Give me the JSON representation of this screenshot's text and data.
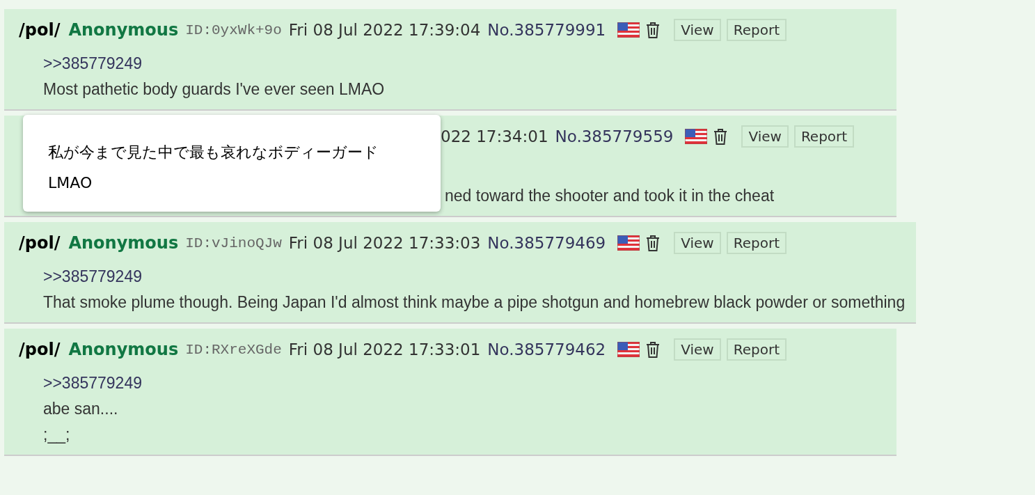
{
  "posts": [
    {
      "board": "/pol/",
      "name": "Anonymous",
      "id": "ID:0yxWk+9o",
      "date": "Fri 08 Jul 2022 17:39:04",
      "number": "No.385779991",
      "buttons": [
        "View",
        "Report"
      ],
      "body": [
        {
          "kind": "quote",
          "text": ">>385779249"
        },
        {
          "kind": "text",
          "text": "Most pathetic body guards I've ever seen LMAO"
        }
      ]
    },
    {
      "date": "022 17:34:01",
      "number": "No.385779559",
      "buttons": [
        "View",
        "Report"
      ],
      "body": [
        {
          "kind": "text",
          "text": "ned toward the shooter and took it in the cheat"
        }
      ]
    },
    {
      "board": "/pol/",
      "name": "Anonymous",
      "id": "ID:vJinoQJw",
      "date": "Fri 08 Jul 2022 17:33:03",
      "number": "No.385779469",
      "buttons": [
        "View",
        "Report"
      ],
      "body": [
        {
          "kind": "quote",
          "text": ">>385779249"
        },
        {
          "kind": "text",
          "text": "That smoke plume though. Being Japan I'd almost think maybe a pipe shotgun and homebrew black powder or something"
        }
      ]
    },
    {
      "board": "/pol/",
      "name": "Anonymous",
      "id": "ID:RXreXGde",
      "date": "Fri 08 Jul 2022 17:33:01",
      "number": "No.385779462",
      "buttons": [
        "View",
        "Report"
      ],
      "body": [
        {
          "kind": "quote",
          "text": ">>385779249"
        },
        {
          "kind": "text",
          "text": "abe san...."
        },
        {
          "kind": "text",
          "text": ";__;"
        }
      ]
    }
  ],
  "tooltip": {
    "text": "私が今まで見た中で最も哀れなボディーガードLMAO"
  }
}
